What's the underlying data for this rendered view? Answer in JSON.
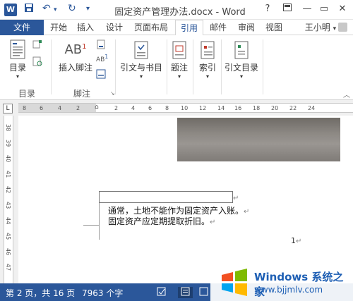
{
  "titlebar": {
    "title": "固定资产管理办法.docx - Word",
    "help": "?",
    "qa_save": "save-icon",
    "qa_undo": "undo-icon",
    "qa_redo": "redo-icon"
  },
  "tabs": {
    "file": "文件",
    "items": [
      "开始",
      "插入",
      "设计",
      "页面布局",
      "引用",
      "邮件",
      "审阅",
      "视图"
    ],
    "active": "引用",
    "user": "王小明"
  },
  "ribbon": {
    "toc": "目录",
    "toc_group": "目录",
    "footnote": "插入脚注",
    "footnote_group": "脚注",
    "citation": "引文与书目",
    "caption": "题注",
    "index": "索引",
    "toa": "引文目录"
  },
  "ruler": {
    "top_marks": [
      "8",
      "6",
      "4",
      "2",
      "2",
      "4",
      "6",
      "8",
      "10",
      "12",
      "14",
      "16",
      "18",
      "20",
      "22",
      "24"
    ],
    "left_marks": [
      "38",
      "39",
      "40",
      "41",
      "42",
      "43",
      "44",
      "45",
      "46",
      "47"
    ]
  },
  "document": {
    "line1": "通常，土地不能作为固定资产入账。",
    "line2": "固定资产应定期提取折旧。",
    "para_mark": "↵",
    "page_number": "1"
  },
  "status": {
    "page": "第 2 页，共 16 页",
    "words": "7963 个字"
  },
  "watermark": {
    "title": "Windows 系统之家",
    "url": "www.bjjmlv.com"
  },
  "colors": {
    "accent": "#2b579a"
  }
}
